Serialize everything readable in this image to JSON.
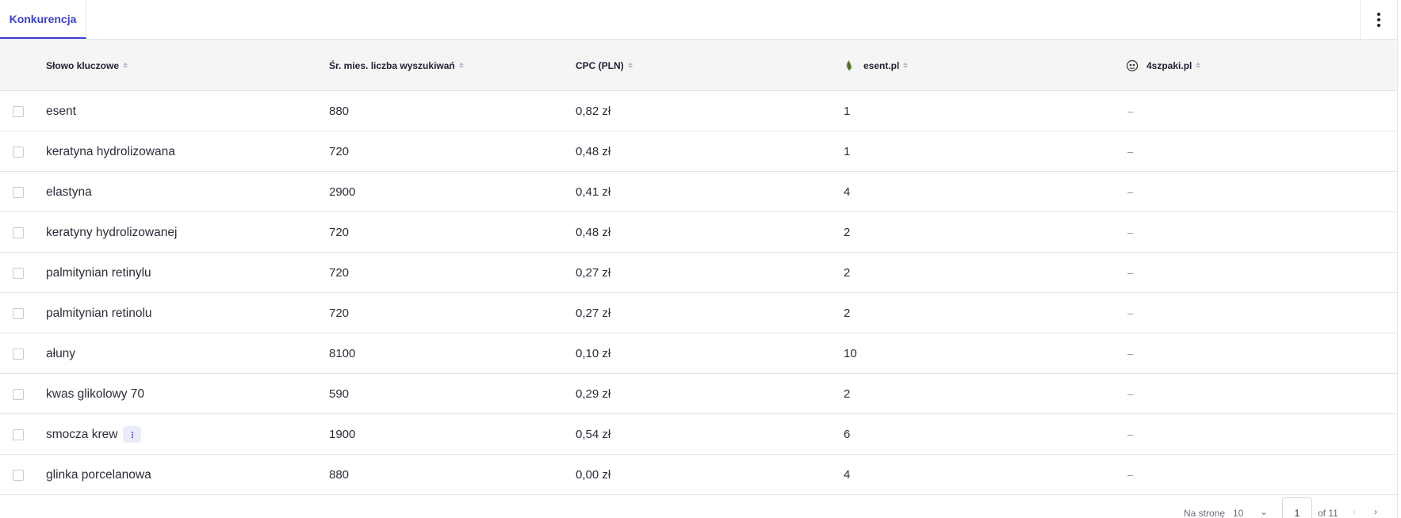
{
  "tabs": [
    {
      "label": "Konkurencja",
      "active": true
    }
  ],
  "columns": {
    "keyword": "Słowo kluczowe",
    "volume": "Śr. mies. liczba wyszukiwań",
    "cpc": "CPC (PLN)",
    "competitor1": "esent.pl",
    "competitor2": "4szpaki.pl"
  },
  "rows": [
    {
      "keyword": "esent",
      "volume": "880",
      "cpc": "0,82 zł",
      "competitor1": "1",
      "competitor2": "–"
    },
    {
      "keyword": "keratyna hydrolizowana",
      "volume": "720",
      "cpc": "0,48 zł",
      "competitor1": "1",
      "competitor2": "–"
    },
    {
      "keyword": "elastyna",
      "volume": "2900",
      "cpc": "0,41 zł",
      "competitor1": "4",
      "competitor2": "–"
    },
    {
      "keyword": "keratyny hydrolizowanej",
      "volume": "720",
      "cpc": "0,48 zł",
      "competitor1": "2",
      "competitor2": "–"
    },
    {
      "keyword": "palmitynian retinylu",
      "volume": "720",
      "cpc": "0,27 zł",
      "competitor1": "2",
      "competitor2": "–"
    },
    {
      "keyword": "palmitynian retinolu",
      "volume": "720",
      "cpc": "0,27 zł",
      "competitor1": "2",
      "competitor2": "–"
    },
    {
      "keyword": "ałuny",
      "volume": "8100",
      "cpc": "0,10 zł",
      "competitor1": "10",
      "competitor2": "–"
    },
    {
      "keyword": "kwas glikolowy 70",
      "volume": "590",
      "cpc": "0,29 zł",
      "competitor1": "2",
      "competitor2": "–"
    },
    {
      "keyword": "smocza krew",
      "volume": "1900",
      "cpc": "0,54 zł",
      "competitor1": "6",
      "competitor2": "–",
      "has_info": true
    },
    {
      "keyword": "glinka porcelanowa",
      "volume": "880",
      "cpc": "0,00 zł",
      "competitor1": "4",
      "competitor2": "–"
    }
  ],
  "pagination": {
    "per_page_label": "Na stronę",
    "per_page_value": "10",
    "current_page": "1",
    "of_label": "of 11",
    "prev_icon": "chevron-left-icon",
    "next_icon": "chevron-right-icon"
  },
  "colors": {
    "accent": "#3b3fd1",
    "header_bg": "#f5f5f6",
    "border": "#e4e4e8"
  }
}
